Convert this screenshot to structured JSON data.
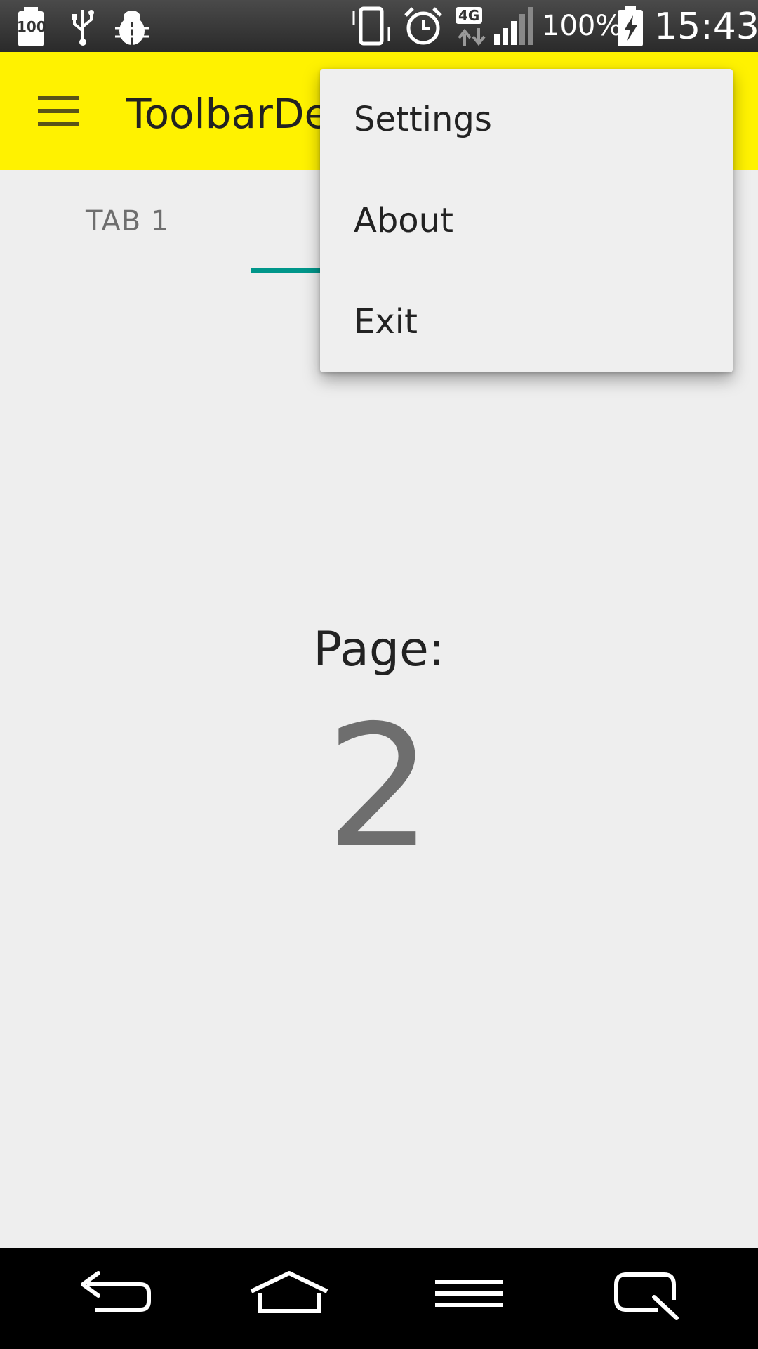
{
  "status_bar": {
    "battery_badge": "100",
    "network_type": "4G",
    "battery_percent": "100%",
    "time": "15:43",
    "icons": [
      "battery-100-icon",
      "usb-icon",
      "debug-bug-icon",
      "vibrate-icon",
      "alarm-icon",
      "network-4g-icon",
      "signal-icon",
      "battery-charging-icon"
    ]
  },
  "toolbar": {
    "title": "ToolbarDemo",
    "background": "#fff200"
  },
  "tabs": {
    "items": [
      {
        "label": "TAB 1"
      }
    ],
    "indicator_color": "#00968a"
  },
  "page": {
    "label": "Page:",
    "number": "2"
  },
  "overflow_menu": {
    "items": [
      {
        "label": "Settings"
      },
      {
        "label": "About"
      },
      {
        "label": "Exit"
      }
    ]
  },
  "nav_bar": {
    "icons": [
      "back-icon",
      "home-icon",
      "menu-icon",
      "qslide-icon"
    ]
  }
}
